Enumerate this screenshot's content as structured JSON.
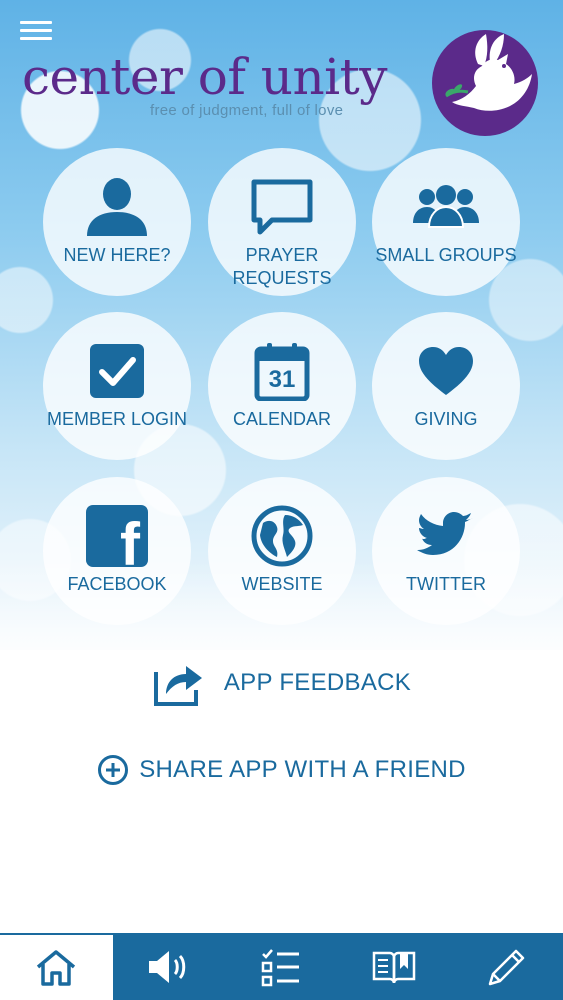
{
  "brand": {
    "title": "center of unity",
    "tagline": "free of judgment, full of love",
    "logo_color": "#5b2a8a"
  },
  "theme": {
    "accent": "#1a6a9e"
  },
  "tiles": [
    {
      "icon": "person-icon",
      "label_1": "NEW HERE?",
      "label_2": ""
    },
    {
      "icon": "chat-bubble-icon",
      "label_1": "PRAYER",
      "label_2": "REQUESTS"
    },
    {
      "icon": "people-group-icon",
      "label_1": "SMALL GROUPS",
      "label_2": ""
    },
    {
      "icon": "checkbox-icon",
      "label_1": "MEMBER LOGIN",
      "label_2": ""
    },
    {
      "icon": "calendar-icon",
      "label_1": "CALENDAR",
      "label_2": "",
      "calendar_day": "31"
    },
    {
      "icon": "heart-icon",
      "label_1": "GIVING",
      "label_2": ""
    },
    {
      "icon": "facebook-icon",
      "label_1": "FACEBOOK",
      "label_2": "",
      "glyph": "f"
    },
    {
      "icon": "globe-icon",
      "label_1": "WEBSITE",
      "label_2": ""
    },
    {
      "icon": "twitter-bird-icon",
      "label_1": "TWITTER",
      "label_2": ""
    }
  ],
  "actions": {
    "feedback": "APP FEEDBACK",
    "share": "SHARE APP WITH A FRIEND"
  },
  "tabbar": {
    "active_index": 0,
    "tabs": [
      "home-icon",
      "speaker-icon",
      "checklist-icon",
      "book-icon",
      "pencil-icon"
    ]
  }
}
